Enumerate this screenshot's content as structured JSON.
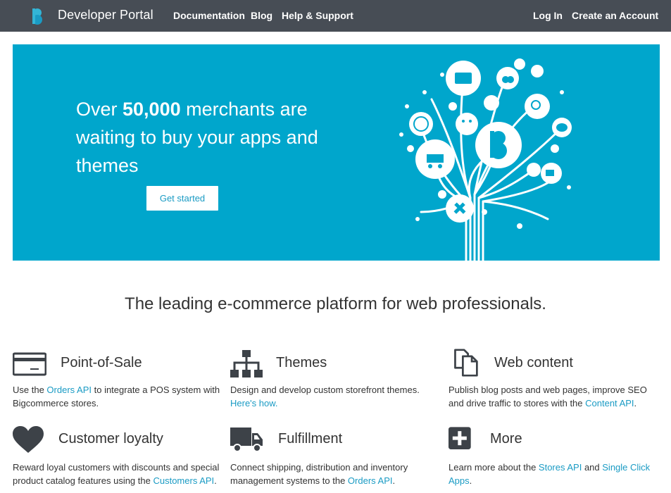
{
  "nav": {
    "brand": "Developer Portal",
    "links": [
      "Documentation",
      "Blog",
      "Help & Support"
    ],
    "login": "Log In",
    "create_account": "Create an Account"
  },
  "hero": {
    "line1_pre": "Over ",
    "line1_bold": "50,000",
    "line1_post": " merchants are",
    "line2": "waiting to buy your apps and",
    "line3": "themes",
    "cta": "Get started",
    "background_color": "#00a6cc"
  },
  "tagline": "The leading e-commerce platform for web professionals.",
  "features": [
    {
      "title": "Point-of-Sale",
      "icon": "credit-card-icon",
      "desc_pre": "Use the ",
      "desc_link": "Orders API",
      "desc_post": " to integrate a POS system with Bigcommerce stores."
    },
    {
      "title": "Themes",
      "icon": "sitemap-icon",
      "desc_pre": "Design and develop custom storefront themes. ",
      "desc_link": "Here's how.",
      "desc_post": ""
    },
    {
      "title": "Web content",
      "icon": "documents-icon",
      "desc_pre": "Publish blog posts and web pages, improve SEO and drive traffic to stores with the ",
      "desc_link": "Content API",
      "desc_post": "."
    },
    {
      "title": "Customer loyalty",
      "icon": "heart-icon",
      "desc_pre": "Reward loyal customers with discounts and special product catalog features using the ",
      "desc_link": "Customers API",
      "desc_post": "."
    },
    {
      "title": "Fulfillment",
      "icon": "truck-icon",
      "desc_pre": "Connect shipping, distribution and inventory management systems to the ",
      "desc_link": "Orders API",
      "desc_post": "."
    },
    {
      "title": "More",
      "icon": "plus-icon",
      "desc_pre": "Learn more about the ",
      "desc_link": "Stores API",
      "desc_mid": " and ",
      "desc_link2": "Single Click Apps",
      "desc_post": "."
    }
  ],
  "colors": {
    "nav_bg": "#474d55",
    "accent": "#00a6cc",
    "link": "#1a9bc4",
    "icon": "#3d4248"
  }
}
